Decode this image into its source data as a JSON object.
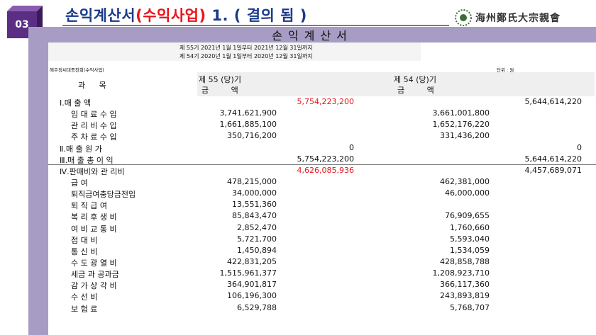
{
  "slide": {
    "number": "03",
    "title_part1": "손익계산서",
    "title_part2": "(수익사업)",
    "title_part3": " 1. ( 결의 됨 )",
    "org_name": "海州鄭氏大宗親會"
  },
  "statement": {
    "title": "손익계산서",
    "period_current": "제 55기  2021년  1월  1일부터  2021년 12월 31일까지",
    "period_prior": "제 54기  2020년  1월  1일부터  2020년 12월 31일까지",
    "company": "해주정씨대종친회(수익사업)",
    "unit": "단위 : 원",
    "subject_header": "과 목",
    "current_header": "제  55 (당)기",
    "prior_header": "제  54 (당)기",
    "amount_header": "금 액"
  },
  "rows": [
    {
      "label": "Ⅰ.매    출    액",
      "kind": "section",
      "c_item": "",
      "c_total": "5,754,223,200",
      "p_item": "",
      "p_total": "5,644,614,220",
      "c_red": true
    },
    {
      "label": "임 대 료 수 입",
      "kind": "item",
      "c_item": "3,741,621,900",
      "c_total": "",
      "p_item": "3,661,001,800",
      "p_total": ""
    },
    {
      "label": "관 리 비 수 입",
      "kind": "item",
      "c_item": "1,661,885,100",
      "c_total": "",
      "p_item": "1,652,176,220",
      "p_total": ""
    },
    {
      "label": "주 차 료 수 입",
      "kind": "item",
      "c_item": "350,716,200",
      "c_total": "",
      "p_item": "331,436,200",
      "p_total": ""
    },
    {
      "label": "Ⅱ.매 출 원 가",
      "kind": "section",
      "c_item": "",
      "c_total": "0",
      "p_item": "",
      "p_total": "0"
    },
    {
      "label": "Ⅲ.매 출 총 이 익",
      "kind": "section",
      "c_item": "",
      "c_total": "5,754,223,200",
      "p_item": "",
      "p_total": "5,644,614,220",
      "sep": true
    },
    {
      "label": "Ⅳ.판매비와 관 리비",
      "kind": "section",
      "c_item": "",
      "c_total": "4,626,085,936",
      "p_item": "",
      "p_total": "4,457,689,071",
      "c_red": true
    },
    {
      "label": "급        여",
      "kind": "item",
      "c_item": "478,215,000",
      "c_total": "",
      "p_item": "462,381,000",
      "p_total": ""
    },
    {
      "label": "퇴직급여충당금전입",
      "kind": "item",
      "c_item": "34,000,000",
      "c_total": "",
      "p_item": "46,000,000",
      "p_total": ""
    },
    {
      "label": "퇴  직  급  여",
      "kind": "item",
      "c_item": "13,551,360",
      "c_total": "",
      "p_item": "",
      "p_total": ""
    },
    {
      "label": "복 리 후 생 비",
      "kind": "item",
      "c_item": "85,843,470",
      "c_total": "",
      "p_item": "76,909,655",
      "p_total": ""
    },
    {
      "label": "여 비 교 통 비",
      "kind": "item",
      "c_item": "2,852,470",
      "c_total": "",
      "p_item": "1,760,660",
      "p_total": ""
    },
    {
      "label": "접       대       비",
      "kind": "item",
      "c_item": "5,721,700",
      "c_total": "",
      "p_item": "5,593,040",
      "p_total": ""
    },
    {
      "label": "통       신       비",
      "kind": "item",
      "c_item": "1,450,894",
      "c_total": "",
      "p_item": "1,534,059",
      "p_total": ""
    },
    {
      "label": "수 도 광 열 비",
      "kind": "item",
      "c_item": "422,831,205",
      "c_total": "",
      "p_item": "428,858,788",
      "p_total": ""
    },
    {
      "label": "세금 과 공과금",
      "kind": "item",
      "c_item": "1,515,961,377",
      "c_total": "",
      "p_item": "1,208,923,710",
      "p_total": ""
    },
    {
      "label": "감 가 상 각 비",
      "kind": "item",
      "c_item": "364,901,817",
      "c_total": "",
      "p_item": "366,117,360",
      "p_total": ""
    },
    {
      "label": "수       선       비",
      "kind": "item",
      "c_item": "106,196,300",
      "c_total": "",
      "p_item": "243,893,819",
      "p_total": ""
    },
    {
      "label": "보       험       료",
      "kind": "item",
      "c_item": "6,529,788",
      "c_total": "",
      "p_item": "5,768,707",
      "p_total": ""
    }
  ],
  "colors": {
    "accent": "#5a2e82",
    "band": "#a79cc4",
    "title": "#1a3a8a",
    "highlight": "#e8141b"
  }
}
